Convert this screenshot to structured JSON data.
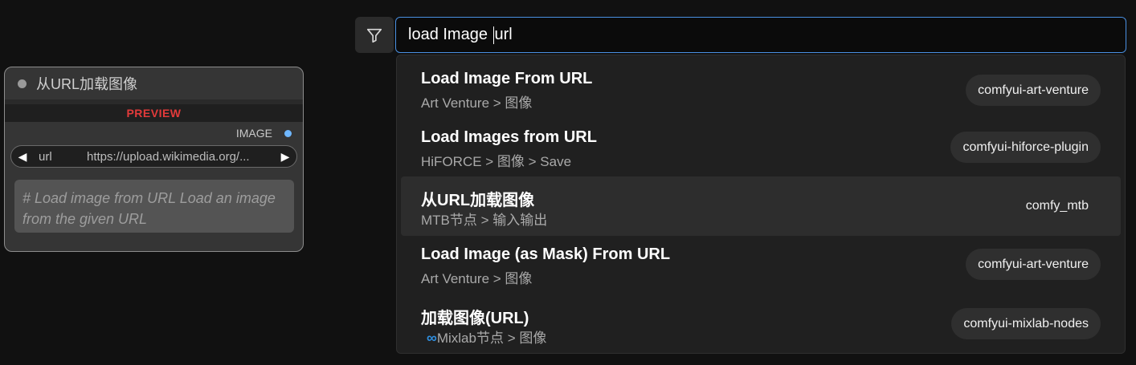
{
  "node": {
    "title": "从URL加载图像",
    "preview_label": "PREVIEW",
    "output_label": "IMAGE",
    "widget": {
      "name": "url",
      "value": "https://upload.wikimedia.org/..."
    },
    "description": "# Load image from URL Load an image from the given URL"
  },
  "search": {
    "query_before_cursor": "load Image ",
    "query_after_cursor": "url"
  },
  "results": [
    {
      "title": "Load Image From URL",
      "path": "Art Venture > 图像",
      "badge": "comfyui-art-venture",
      "active": false
    },
    {
      "title": "Load Images from URL",
      "path": "HiFORCE > 图像 > Save",
      "badge": "comfyui-hiforce-plugin",
      "active": false
    },
    {
      "title": "从URL加载图像",
      "path": "MTB节点 > 输入输出",
      "badge": "comfy_mtb",
      "active": true
    },
    {
      "title": "Load Image (as Mask) From URL",
      "path": "Art Venture > 图像",
      "badge": "comfyui-art-venture",
      "active": false
    },
    {
      "title": "加载图像(URL)",
      "path_prefix": "∞",
      "path": "Mixlab节点 > 图像",
      "badge": "comfyui-mixlab-nodes",
      "active": false
    }
  ],
  "icons": {
    "filter": "filter-icon",
    "left_arrow": "left-arrow-icon",
    "right_arrow": "right-arrow-icon"
  },
  "colors": {
    "accent": "#4a90e2",
    "preview_red": "#e23a3a",
    "output_dot": "#6fb7ff",
    "active_row": "#2d2d2d"
  }
}
